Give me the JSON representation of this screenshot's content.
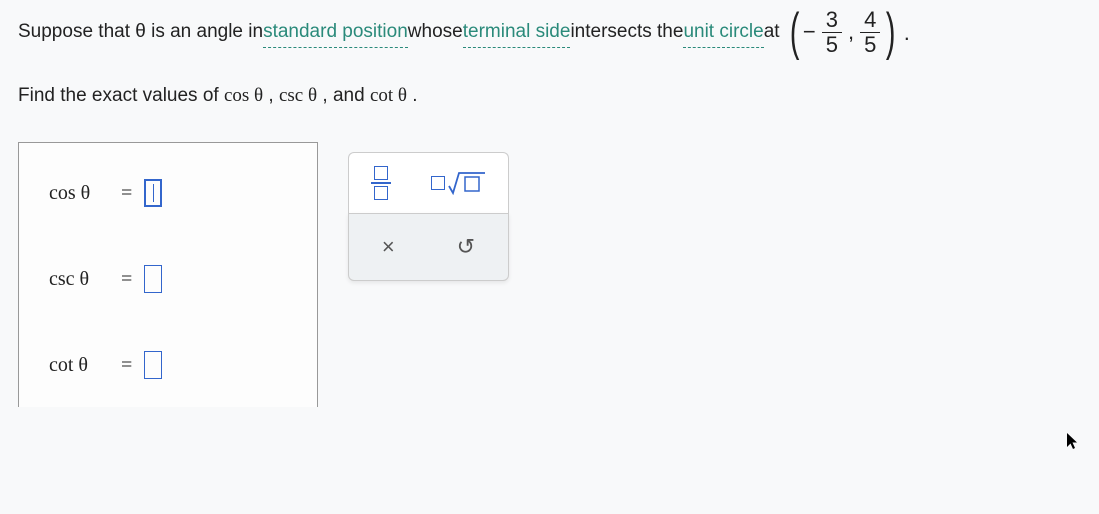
{
  "statement": {
    "part1": "Suppose that θ is an angle in ",
    "term1": "standard position",
    "part2": " whose ",
    "term2": "terminal side",
    "part3": " intersects the ",
    "term3": "unit circle",
    "part4": " at ",
    "coord": {
      "minus": "−",
      "num1": "3",
      "den1": "5",
      "comma": ",",
      "num2": "4",
      "den2": "5"
    },
    "period": "."
  },
  "find_line": {
    "prefix": "Find the exact values of ",
    "f1": "cos θ",
    "sep1": ", ",
    "f2": "csc θ",
    "sep2": ", and ",
    "f3": "cot θ",
    "suffix": "."
  },
  "answers": {
    "row1": {
      "label": "cos θ",
      "eq": "="
    },
    "row2": {
      "label": "csc θ",
      "eq": "="
    },
    "row3": {
      "label": "cot θ",
      "eq": "="
    }
  },
  "toolbox": {
    "close": "×",
    "undo": "↺"
  }
}
